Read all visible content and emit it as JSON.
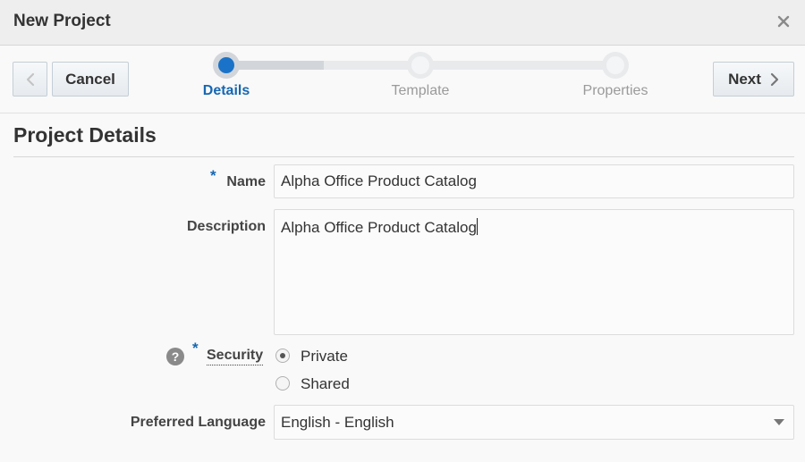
{
  "dialog": {
    "title": "New Project",
    "close_icon": "close-icon"
  },
  "toolbar": {
    "back_icon": "chevron-left-icon",
    "cancel_label": "Cancel",
    "next_label": "Next",
    "next_icon": "chevron-right-icon"
  },
  "train": {
    "steps": [
      {
        "label": "Details",
        "state": "current"
      },
      {
        "label": "Template",
        "state": "pending"
      },
      {
        "label": "Properties",
        "state": "pending"
      }
    ],
    "accent_color": "#1a73c8"
  },
  "section": {
    "title": "Project Details"
  },
  "form": {
    "required_marker": "*",
    "name": {
      "label": "Name",
      "value": "Alpha Office Product Catalog",
      "required": true
    },
    "description": {
      "label": "Description",
      "value": "Alpha Office Product Catalog"
    },
    "security": {
      "label": "Security",
      "help_icon": "help-icon",
      "help_glyph": "?",
      "required": true,
      "options": [
        {
          "label": "Private",
          "checked": true
        },
        {
          "label": "Shared",
          "checked": false
        }
      ]
    },
    "language": {
      "label": "Preferred Language",
      "value": "English - English"
    }
  }
}
